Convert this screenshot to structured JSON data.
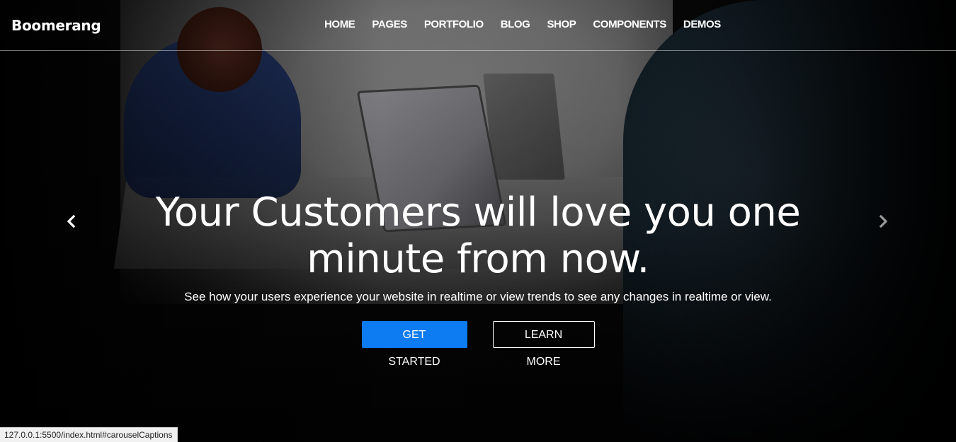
{
  "brand": "Boomerang",
  "nav": {
    "items": [
      "HOME",
      "PAGES",
      "PORTFOLIO",
      "BLOG",
      "SHOP",
      "COMPONENTS",
      "DEMOS"
    ]
  },
  "hero": {
    "headline": "Your Customers will love you one minute from now.",
    "subtext": "See how your users experience your website in realtime or view trends to see any changes in realtime or view.",
    "primary_button": "GET STARTED",
    "secondary_button": "LEARN MORE"
  },
  "carousel": {
    "prev_icon": "chevron-left-icon",
    "next_icon": "chevron-right-icon"
  },
  "status_bar": {
    "url": "127.0.0.1:5500/index.html#carouselCaptions"
  },
  "colors": {
    "primary": "#0d7bf2",
    "text": "#ffffff"
  }
}
